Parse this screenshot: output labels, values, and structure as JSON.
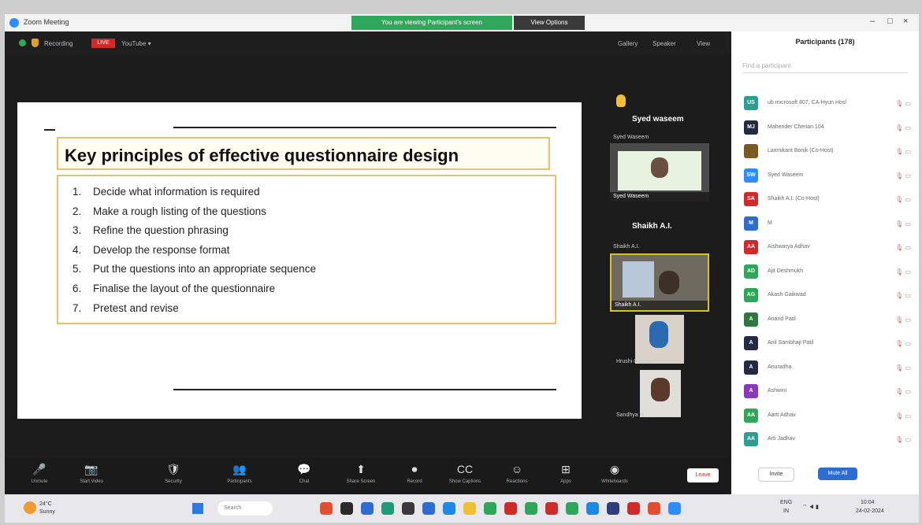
{
  "window": {
    "title": "Zoom Meeting",
    "share_banner": "You are viewing Participant's screen",
    "view_options": "View Options",
    "minimize": "–",
    "maximize": "□",
    "close": "×"
  },
  "meeting_bar": {
    "recording_label": "Recording",
    "live_badge": "LIVE",
    "youtube_label": "YouTube ▾",
    "top_right_1": "Gallery",
    "top_right_2": "Speaker",
    "top_right_3": "View"
  },
  "slide": {
    "title": "Key principles of effective questionnaire design",
    "items": [
      {
        "num": "1.",
        "text": "Decide what information is required"
      },
      {
        "num": "2.",
        "text": "Make a rough listing of the questions"
      },
      {
        "num": "3.",
        "text": "Refine the question phrasing"
      },
      {
        "num": "4.",
        "text": "Develop the response format"
      },
      {
        "num": "5.",
        "text": "Put the questions into an appropriate sequence"
      },
      {
        "num": "6.",
        "text": "Finalise the layout of the questionnaire"
      },
      {
        "num": "7.",
        "text": "Pretest and revise"
      }
    ]
  },
  "videos": {
    "speaker1_name": "Syed waseem",
    "speaker1_sub": "Syed Waseem",
    "speaker2_name": "Shaikh A.I.",
    "speaker2_sub": "Shaikh A.I.",
    "thumb1_label": "Syed Waseem",
    "thumb2_label": "Shaikh A.I.",
    "thumb3_label": "Hrushi Gaikwad",
    "thumb4_label": "Sandhya M"
  },
  "participants": {
    "title": "Participants (178)",
    "search_placeholder": "Find a participant",
    "list": [
      {
        "initials": "US",
        "name": "ub microsoft 807, CA-Hyun Hosl",
        "color": "#2e9c8f"
      },
      {
        "initials": "MJ",
        "name": "Mahender Cherian 104",
        "color": "#222a44"
      },
      {
        "initials": "",
        "name": "Laxmikant Bonik (Co-Host)",
        "color": "#7a5a1e"
      },
      {
        "initials": "SW",
        "name": "Syed Waseem",
        "color": "#2d8cff"
      },
      {
        "initials": "SA",
        "name": "Shaikh A.I. (Co-Host)",
        "color": "#d12a2a"
      },
      {
        "initials": "M",
        "name": "M",
        "color": "#2d6cd0"
      },
      {
        "initials": "AA",
        "name": "Aishwarya Adhav",
        "color": "#d12a2a"
      },
      {
        "initials": "AD",
        "name": "Ajit Deshmukh",
        "color": "#2ea75a"
      },
      {
        "initials": "AG",
        "name": "Akash Gaikwad",
        "color": "#2ea75a"
      },
      {
        "initials": "A",
        "name": "Anand Patil",
        "color": "#2e7a3e"
      },
      {
        "initials": "A",
        "name": "Anil Sambhaji Patil",
        "color": "#222a44"
      },
      {
        "initials": "A",
        "name": "Anuradha",
        "color": "#222a44"
      },
      {
        "initials": "A",
        "name": "Ashwini",
        "color": "#8a3ab8"
      },
      {
        "initials": "AA",
        "name": "Aarti Adhav",
        "color": "#2ea75a"
      },
      {
        "initials": "AA",
        "name": "Arti Jadhav",
        "color": "#2e9c8f"
      }
    ],
    "invite_label": "Invite",
    "mute_all_label": "Mute All"
  },
  "toolbar": {
    "items": [
      {
        "icon": "🎤",
        "label": "Unmute"
      },
      {
        "icon": "📷",
        "label": "Start Video"
      },
      {
        "icon": "🛡",
        "label": "Security"
      },
      {
        "icon": "👥",
        "label": "Participants"
      },
      {
        "icon": "💬",
        "label": "Chat"
      },
      {
        "icon": "⬆",
        "label": "Share Screen"
      },
      {
        "icon": "⏺",
        "label": "Record"
      },
      {
        "icon": "CC",
        "label": "Show Captions"
      },
      {
        "icon": "☺",
        "label": "Reactions"
      },
      {
        "icon": "⊞",
        "label": "Apps"
      },
      {
        "icon": "◉",
        "label": "Whiteboards"
      }
    ],
    "end_label": "Leave"
  },
  "taskbar": {
    "weather_temp": "24°C",
    "weather_desc": "Sunny",
    "search_placeholder": "Search",
    "lang": "ENG",
    "lang_sub": "IN",
    "time": "10:04",
    "date": "24-02-2024"
  }
}
